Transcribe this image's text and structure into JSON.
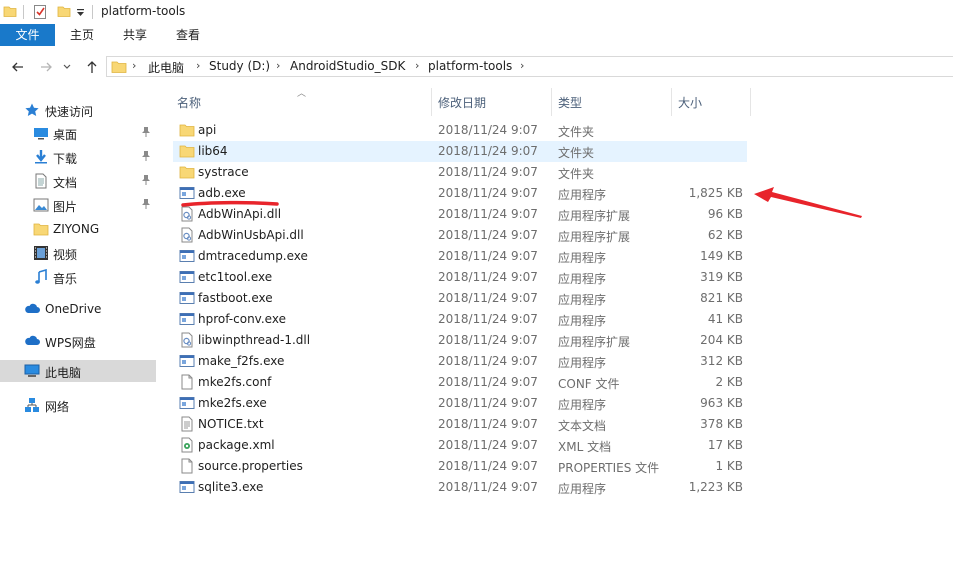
{
  "window": {
    "title": "platform-tools"
  },
  "ribbon": {
    "tabs": [
      "文件",
      "主页",
      "共享",
      "查看"
    ]
  },
  "address": {
    "crumbs": [
      "此电脑",
      "Study (D:)",
      "AndroidStudio_SDK",
      "platform-tools"
    ]
  },
  "sidebar": {
    "items": [
      {
        "label": "快速访问",
        "icon": "star-icon",
        "pinned": false
      },
      {
        "label": "桌面",
        "icon": "desktop-icon",
        "pinned": true
      },
      {
        "label": "下载",
        "icon": "download-icon",
        "pinned": true
      },
      {
        "label": "文档",
        "icon": "document-icon",
        "pinned": true
      },
      {
        "label": "图片",
        "icon": "picture-icon",
        "pinned": true
      },
      {
        "label": "ZIYONG",
        "icon": "folder-icon",
        "pinned": false
      },
      {
        "label": "视频",
        "icon": "video-icon",
        "pinned": false
      },
      {
        "label": "音乐",
        "icon": "music-icon",
        "pinned": false
      },
      {
        "label": "OneDrive",
        "icon": "cloud-icon",
        "pinned": false
      },
      {
        "label": "WPS网盘",
        "icon": "cloud-icon",
        "pinned": false
      },
      {
        "label": "此电脑",
        "icon": "computer-icon",
        "pinned": false,
        "selected": true
      },
      {
        "label": "网络",
        "icon": "network-icon",
        "pinned": false
      }
    ]
  },
  "columns": {
    "name": "名称",
    "date": "修改日期",
    "type": "类型",
    "size": "大小"
  },
  "files": [
    {
      "name": "api",
      "date": "2018/11/24 9:07",
      "type": "文件夹",
      "size": "",
      "icon": "folder"
    },
    {
      "name": "lib64",
      "date": "2018/11/24 9:07",
      "type": "文件夹",
      "size": "",
      "icon": "folder",
      "highlighted": true
    },
    {
      "name": "systrace",
      "date": "2018/11/24 9:07",
      "type": "文件夹",
      "size": "",
      "icon": "folder"
    },
    {
      "name": "adb.exe",
      "date": "2018/11/24 9:07",
      "type": "应用程序",
      "size": "1,825 KB",
      "icon": "exe"
    },
    {
      "name": "AdbWinApi.dll",
      "date": "2018/11/24 9:07",
      "type": "应用程序扩展",
      "size": "96 KB",
      "icon": "dll"
    },
    {
      "name": "AdbWinUsbApi.dll",
      "date": "2018/11/24 9:07",
      "type": "应用程序扩展",
      "size": "62 KB",
      "icon": "dll"
    },
    {
      "name": "dmtracedump.exe",
      "date": "2018/11/24 9:07",
      "type": "应用程序",
      "size": "149 KB",
      "icon": "exe"
    },
    {
      "name": "etc1tool.exe",
      "date": "2018/11/24 9:07",
      "type": "应用程序",
      "size": "319 KB",
      "icon": "exe"
    },
    {
      "name": "fastboot.exe",
      "date": "2018/11/24 9:07",
      "type": "应用程序",
      "size": "821 KB",
      "icon": "exe"
    },
    {
      "name": "hprof-conv.exe",
      "date": "2018/11/24 9:07",
      "type": "应用程序",
      "size": "41 KB",
      "icon": "exe"
    },
    {
      "name": "libwinpthread-1.dll",
      "date": "2018/11/24 9:07",
      "type": "应用程序扩展",
      "size": "204 KB",
      "icon": "dll"
    },
    {
      "name": "make_f2fs.exe",
      "date": "2018/11/24 9:07",
      "type": "应用程序",
      "size": "312 KB",
      "icon": "exe"
    },
    {
      "name": "mke2fs.conf",
      "date": "2018/11/24 9:07",
      "type": "CONF 文件",
      "size": "2 KB",
      "icon": "file"
    },
    {
      "name": "mke2fs.exe",
      "date": "2018/11/24 9:07",
      "type": "应用程序",
      "size": "963 KB",
      "icon": "exe"
    },
    {
      "name": "NOTICE.txt",
      "date": "2018/11/24 9:07",
      "type": "文本文档",
      "size": "378 KB",
      "icon": "txt"
    },
    {
      "name": "package.xml",
      "date": "2018/11/24 9:07",
      "type": "XML 文档",
      "size": "17 KB",
      "icon": "xml"
    },
    {
      "name": "source.properties",
      "date": "2018/11/24 9:07",
      "type": "PROPERTIES 文件",
      "size": "1 KB",
      "icon": "file"
    },
    {
      "name": "sqlite3.exe",
      "date": "2018/11/24 9:07",
      "type": "应用程序",
      "size": "1,223 KB",
      "icon": "exe"
    }
  ],
  "colors": {
    "accent": "#1979ca",
    "folder": "#f8d775",
    "annotation": "#e8242b",
    "hover": "#e5f3ff"
  }
}
